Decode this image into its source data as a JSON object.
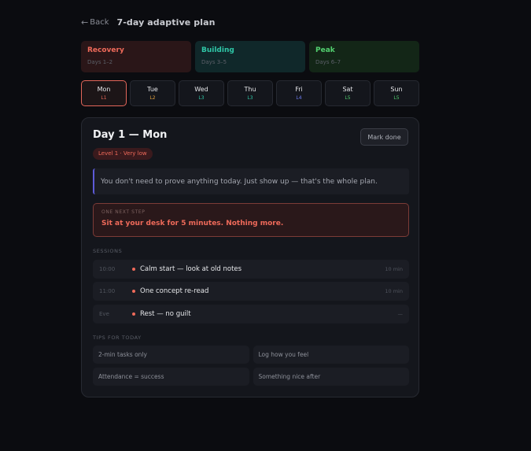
{
  "header": {
    "back_label": "Back",
    "title": "7-day adaptive plan"
  },
  "phases": [
    {
      "name": "Recovery",
      "days": "Days 1–2",
      "color": "#ef6a5a"
    },
    {
      "name": "Building",
      "days": "Days 3–5",
      "color": "#2fc7a7"
    },
    {
      "name": "Peak",
      "days": "Days 6–7",
      "color": "#52d06f"
    }
  ],
  "days": [
    {
      "name": "Mon",
      "level": "L1",
      "color": "#ef6a5a",
      "active": true
    },
    {
      "name": "Tue",
      "level": "L2",
      "color": "#e3a13c"
    },
    {
      "name": "Wed",
      "level": "L3",
      "color": "#2fc7a7"
    },
    {
      "name": "Thu",
      "level": "L3",
      "color": "#2fc7a7"
    },
    {
      "name": "Fri",
      "level": "L4",
      "color": "#6e7cf2"
    },
    {
      "name": "Sat",
      "level": "L5",
      "color": "#52d06f"
    },
    {
      "name": "Sun",
      "level": "L5",
      "color": "#52d06f"
    }
  ],
  "detail": {
    "title": "Day 1 — Mon",
    "mark_done_label": "Mark done",
    "level_badge": "Level 1 · Very low",
    "quote": "You don't need to prove anything today. Just show up — that's the whole plan.",
    "next_step_label": "ONE NEXT STEP",
    "next_step_text": "Sit at your desk for 5 minutes. Nothing more.",
    "sessions_label": "SESSIONS",
    "sessions": [
      {
        "time": "10:00",
        "name": "Calm start — look at old notes",
        "duration": "10 min"
      },
      {
        "time": "11:00",
        "name": "One concept re-read",
        "duration": "10 min"
      },
      {
        "time": "Eve",
        "name": "Rest — no guilt",
        "duration": "—"
      }
    ],
    "tips_label": "TIPS FOR TODAY",
    "tips": [
      "2-min tasks only",
      "Log how you feel",
      "Attendance = success",
      "Something nice after"
    ]
  },
  "colors": {
    "accent": "#ef6a5a",
    "quote_bar": "#5d5ad8",
    "background": "#0b0c10"
  }
}
